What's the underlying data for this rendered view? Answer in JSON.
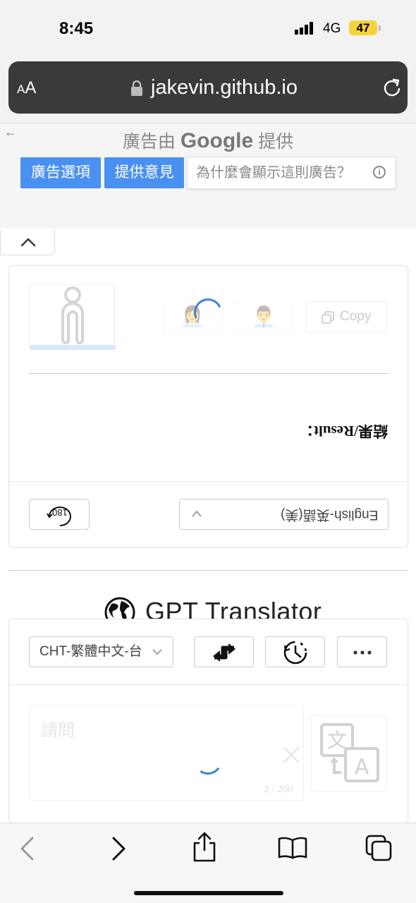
{
  "status": {
    "time": "8:45",
    "network": "4G",
    "battery": "47"
  },
  "browser": {
    "aa_small": "A",
    "aa_large": "A",
    "url": "jakevin.github.io"
  },
  "ad": {
    "back_arrow": "←",
    "by_prefix": "廣告由",
    "brand": "Google",
    "by_suffix": "提供",
    "options_label": "廣告選項",
    "feedback_label": "提供意見",
    "why_label": "為什麼會顯示這則廣告？",
    "info_glyph": "i"
  },
  "result_card": {
    "copy_label": "Copy",
    "result_label": "結果/Result：",
    "rotate_label": "180",
    "language_select": "English-英語(美)",
    "avatar_female": "👩‍💼",
    "avatar_male": "👨‍💼"
  },
  "app": {
    "title": "GPT Translator"
  },
  "translator": {
    "source_language": "CHT-繁體中文-台",
    "placeholder": "請問",
    "counter": "2 / 200",
    "icons": [
      "swap-icon",
      "history-icon",
      "more-icon",
      "translate-icon"
    ]
  },
  "colors": {
    "accent": "#4a90f0",
    "spinner": "#3b82d6",
    "battery": "#f5d23a",
    "url_bar": "#3a3a3c"
  }
}
